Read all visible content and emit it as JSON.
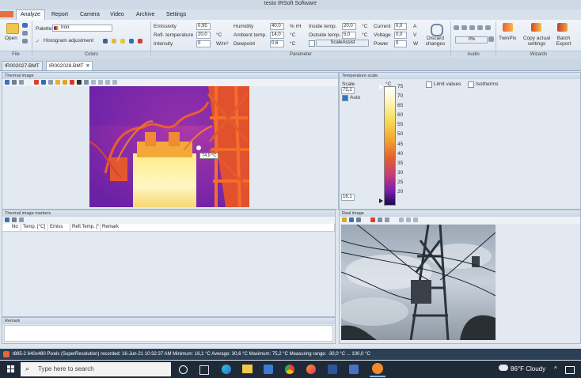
{
  "window": {
    "title": "testo IRSoft Software"
  },
  "menu": [
    "Analyze",
    "Report",
    "Camera",
    "Video",
    "Archive",
    "Settings"
  ],
  "ribbon": {
    "file": {
      "open": "Open",
      "footer": "File"
    },
    "colors": {
      "palette_label": "Palette:",
      "palette_value": "Iron",
      "histogram": "Histogram adjustment",
      "footer": "Colors"
    },
    "parameter": {
      "emissivity_label": "Emissivity",
      "emissivity": "0,95",
      "refl_temp_label": "Refl. temperature",
      "refl_temp": "20,0",
      "refl_temp_unit": "°C",
      "intensity_label": "Intensity",
      "intensity": "0",
      "intensity_unit": "W/m²",
      "humidity_label": "Humidity",
      "humidity": "40,0",
      "humidity_unit": "% rH",
      "ambient_label": "Ambient temp.",
      "ambient": "14,0",
      "ambient_unit": "°C",
      "dewpoint_label": "Dewpoint",
      "dewpoint": "0,6",
      "dewpoint_unit": "°C",
      "inside_label": "Inside temp.",
      "inside": "20,0",
      "inside_unit": "°C",
      "outside_label": "Outside temp.",
      "outside": "5,0",
      "outside_unit": "°C",
      "scaleassist": "ScaleAssist",
      "current_label": "Current",
      "current": "0,0",
      "current_unit": "A",
      "voltage_label": "Voltage",
      "voltage": "0,0",
      "voltage_unit": "V",
      "power_label": "Power",
      "power": "0",
      "power_unit": "W",
      "discard": "Discard changes",
      "footer": "Parameter"
    },
    "audio": {
      "percent": "0%",
      "footer": "Audio"
    },
    "wizards": {
      "twinpix": "TwinPix",
      "copy": "Copy actual settings",
      "batch": "Batch Export",
      "footer": "Wizards"
    }
  },
  "doc_tabs": [
    "IR002027.BMT",
    "IR002028.BMT"
  ],
  "panels": {
    "thermal": {
      "title": "Thermal image",
      "marker_label": "74,9 °C"
    },
    "scale": {
      "title": "Temperature scale",
      "scale_label": "Scale",
      "max_value": "75,2",
      "min_value": "16,1",
      "auto": "Auto",
      "unit": "°C",
      "ticks": [
        "75",
        "70",
        "65",
        "60",
        "55",
        "50",
        "45",
        "40",
        "35",
        "30",
        "25",
        "20"
      ],
      "limit_values": "Limit values",
      "isotherms": "Isotherms"
    },
    "markers": {
      "title": "Thermal image markers",
      "columns": [
        "No",
        "Temp. [°C]",
        "Emiss",
        "Refl.Temp. [°",
        "Remark"
      ]
    },
    "real": {
      "title": "Real image"
    },
    "remark": {
      "title": "Remark"
    }
  },
  "statusbar": "t885-2  640x480 Pixels (SuperResolution)  recorded: 16-Jun-21  10:32:37 AM  Minimum: 16,1 °C  Average: 30,6 °C  Maximum: 75,2 °C  Measuring range: -30,0 °C ... 100,0 °C",
  "taskbar": {
    "search_placeholder": "Type here to search",
    "weather": "86°F  Cloudy"
  },
  "colors": {
    "accent": "#2b78c5",
    "taskbar": "#1f2a38",
    "ribbon": "#e6edf4"
  }
}
